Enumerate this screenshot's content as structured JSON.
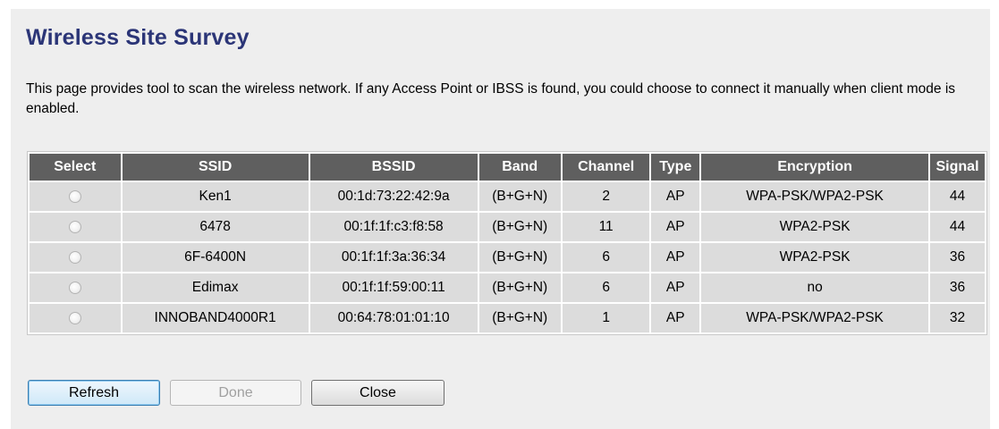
{
  "page": {
    "title": "Wireless Site Survey",
    "description": "This page provides tool to scan the wireless network. If any Access Point or IBSS is found, you could choose to connect it manually when client mode is enabled."
  },
  "table": {
    "headers": [
      "Select",
      "SSID",
      "BSSID",
      "Band",
      "Channel",
      "Type",
      "Encryption",
      "Signal"
    ],
    "rows": [
      {
        "ssid": "Ken1",
        "bssid": "00:1d:73:22:42:9a",
        "band": "(B+G+N)",
        "channel": "2",
        "type": "AP",
        "encryption": "WPA-PSK/WPA2-PSK",
        "signal": "44"
      },
      {
        "ssid": "6478",
        "bssid": "00:1f:1f:c3:f8:58",
        "band": "(B+G+N)",
        "channel": "11",
        "type": "AP",
        "encryption": "WPA2-PSK",
        "signal": "44"
      },
      {
        "ssid": "6F-6400N",
        "bssid": "00:1f:1f:3a:36:34",
        "band": "(B+G+N)",
        "channel": "6",
        "type": "AP",
        "encryption": "WPA2-PSK",
        "signal": "36"
      },
      {
        "ssid": "Edimax",
        "bssid": "00:1f:1f:59:00:11",
        "band": "(B+G+N)",
        "channel": "6",
        "type": "AP",
        "encryption": "no",
        "signal": "36"
      },
      {
        "ssid": "INNOBAND4000R1",
        "bssid": "00:64:78:01:01:10",
        "band": "(B+G+N)",
        "channel": "1",
        "type": "AP",
        "encryption": "WPA-PSK/WPA2-PSK",
        "signal": "32"
      }
    ]
  },
  "buttons": {
    "refresh": "Refresh",
    "done": "Done",
    "close": "Close"
  },
  "colors": {
    "title": "#2b3577",
    "panel_background": "#eeeeee",
    "header_background": "#5f5f5f",
    "row_background": "#dcdcdc"
  }
}
